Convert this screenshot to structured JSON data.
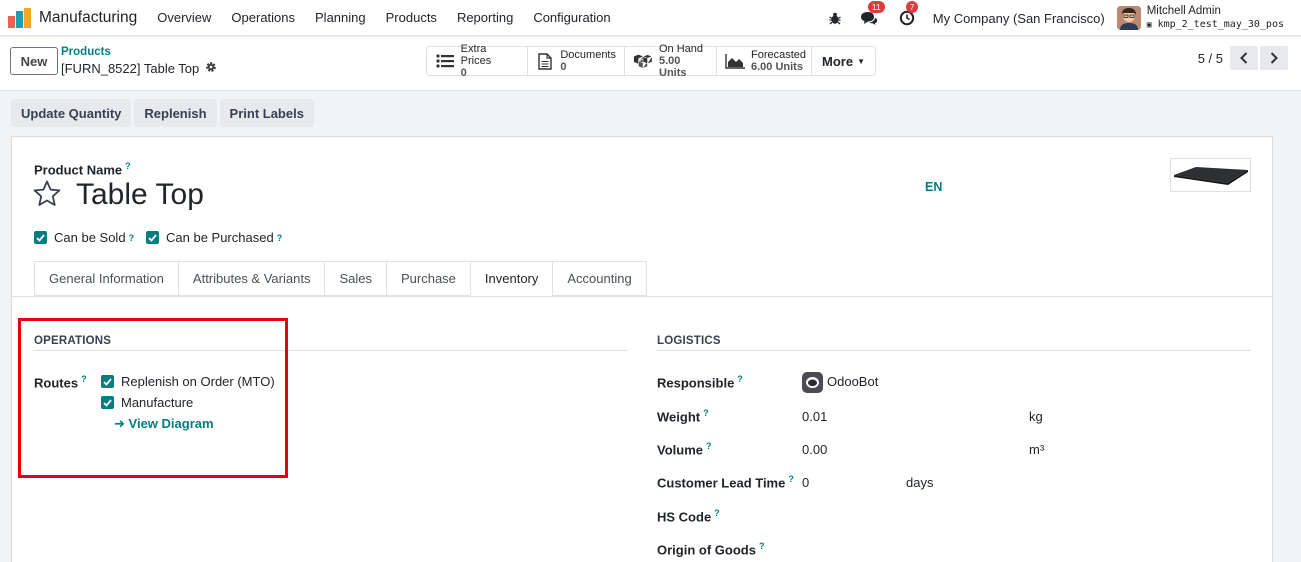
{
  "navbar": {
    "app_name": "Manufacturing",
    "menu": [
      "Overview",
      "Operations",
      "Planning",
      "Products",
      "Reporting",
      "Configuration"
    ],
    "chat_badge": "11",
    "activity_badge": "7",
    "company": "My Company (San Francisco)",
    "user_name": "Mitchell Admin",
    "database": "kmp_2_test_may_30_pos",
    "icons": [
      "bug-icon",
      "chat-icon",
      "clock-icon"
    ]
  },
  "control": {
    "new_label": "New",
    "breadcrumb_parent": "Products",
    "breadcrumb_current": "[FURN_8522] Table Top",
    "stats": [
      {
        "label": "Extra Prices",
        "value": "0"
      },
      {
        "label": "Documents",
        "value": "0"
      },
      {
        "label": "On Hand",
        "value": "5.00 Units"
      },
      {
        "label": "Forecasted",
        "value": "6.00 Units"
      }
    ],
    "more_label": "More",
    "pager": "5 / 5"
  },
  "actions": [
    "Update Quantity",
    "Replenish",
    "Print Labels"
  ],
  "form": {
    "product_name_label": "Product Name",
    "help_mark": "?",
    "product_name": "Table Top",
    "lang": "EN",
    "can_be_sold": "Can be Sold",
    "can_be_purchased": "Can be Purchased",
    "tabs": [
      "General Information",
      "Attributes & Variants",
      "Sales",
      "Purchase",
      "Inventory",
      "Accounting"
    ],
    "active_tab": "Inventory",
    "operations": {
      "title": "OPERATIONS",
      "routes_label": "Routes",
      "routes": [
        "Replenish on Order (MTO)",
        "Manufacture"
      ],
      "view_diagram": "View Diagram"
    },
    "logistics": {
      "title": "LOGISTICS",
      "responsible_label": "Responsible",
      "responsible": "OdooBot",
      "weight_label": "Weight",
      "weight": "0.01",
      "weight_unit": "kg",
      "volume_label": "Volume",
      "volume": "0.00",
      "volume_unit": "m³",
      "lead_time_label": "Customer Lead Time",
      "lead_time": "0",
      "lead_time_unit": "days",
      "hs_code_label": "HS Code",
      "origin_label": "Origin of Goods"
    }
  },
  "colors": {
    "accent": "#017e84",
    "highlight": "#e8000b",
    "badge": "#e4393c"
  }
}
